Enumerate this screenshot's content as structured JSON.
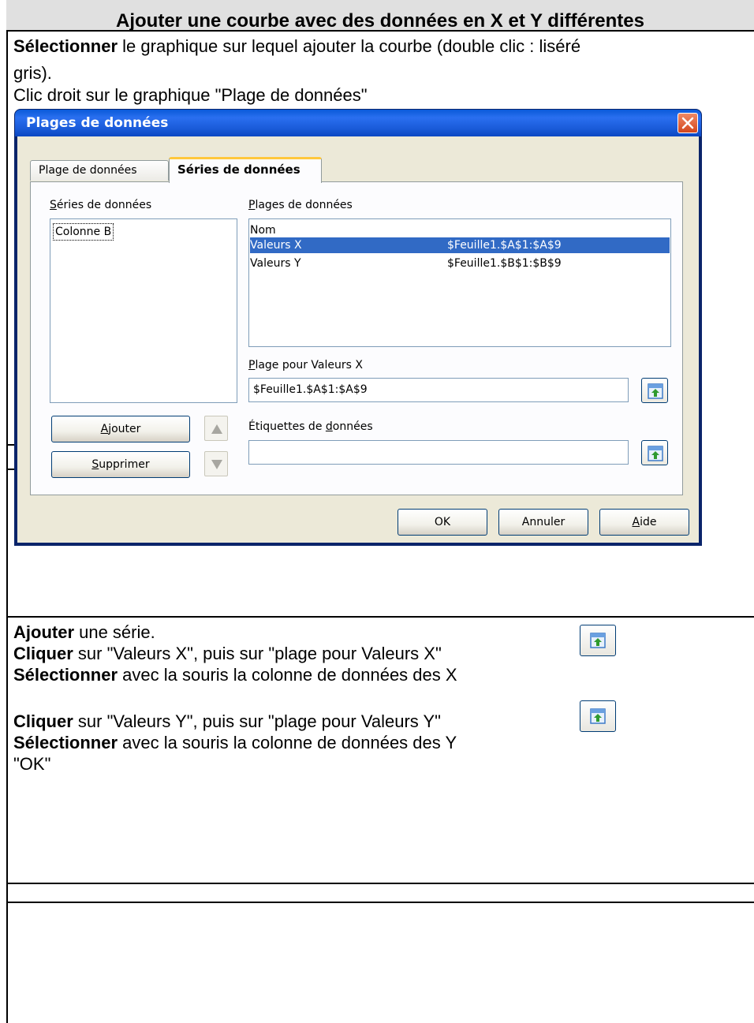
{
  "document": {
    "title": "Ajouter une courbe avec des données en X et Y différentes",
    "intro": {
      "line1_bold": "Sélectionner",
      "line1_rest": " le graphique sur lequel ajouter la courbe (double clic : liséré",
      "line2": "gris).",
      "line3": "Clic droit sur le graphique \"Plage de données\""
    },
    "steps": {
      "s1_bold": "Ajouter",
      "s1_rest": " une série.",
      "s2_bold": "Cliquer",
      "s2_rest": " sur \"Valeurs X\", puis sur  \"plage pour Valeurs X\"",
      "s3_bold": "Sélectionner",
      "s3_rest": " avec la souris la colonne de données des X",
      "s4_bold": "Cliquer",
      "s4_rest": " sur \"Valeurs Y\", puis sur   \"plage pour Valeurs Y\"",
      "s5_bold": "Sélectionner",
      "s5_rest": " avec la souris la colonne de données des Y",
      "s6": "\"OK\""
    }
  },
  "dialog": {
    "title": "Plages de données",
    "tabs": [
      "Plage de données",
      "Séries de données"
    ],
    "series_label": "Séries de données",
    "series_items": [
      "Colonne B"
    ],
    "ranges_label": "Plages de données",
    "ranges": [
      {
        "role": "Nom",
        "range": ""
      },
      {
        "role": "Valeurs X",
        "range": "$Feuille1.$A$1:$A$9"
      },
      {
        "role": "Valeurs Y",
        "range": "$Feuille1.$B$1:$B$9"
      }
    ],
    "range_for_label": "Plage pour Valeurs X",
    "range_for_value": "$Feuille1.$A$1:$A$9",
    "labels_label": "Étiquettes de données",
    "labels_value": "",
    "buttons": {
      "add": "Ajouter",
      "remove": "Supprimer",
      "ok": "OK",
      "cancel": "Annuler",
      "help": "Aide"
    }
  },
  "colors": {
    "title_bg": "#e0e0e0",
    "selection": "#316ac5",
    "titlebar": "#0a5ad8",
    "dialog_face": "#ece9d8"
  },
  "icons": [
    "close-icon",
    "shrink-range-icon",
    "move-up-icon",
    "move-down-icon"
  ]
}
